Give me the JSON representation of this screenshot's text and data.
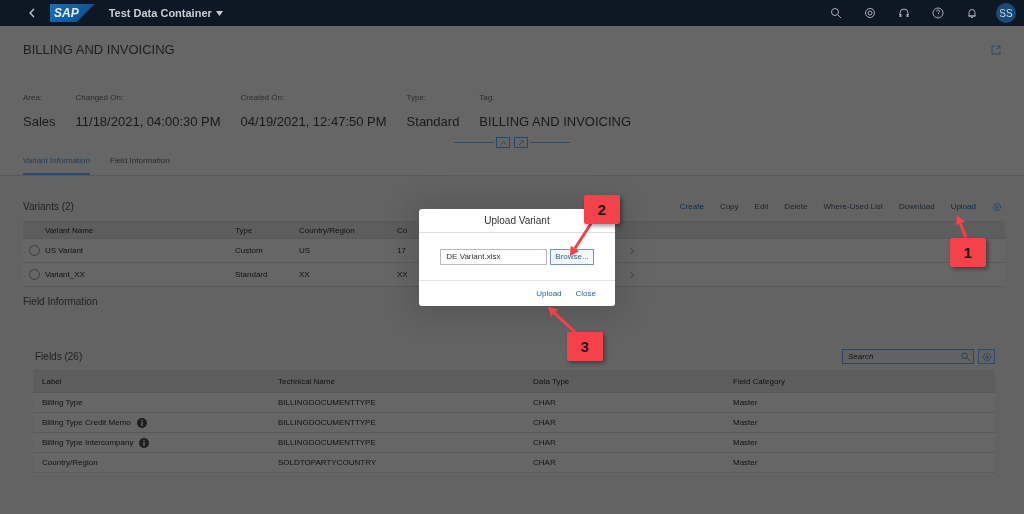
{
  "shell": {
    "logo": "SAP",
    "title": "Test Data Container",
    "avatar": "SS"
  },
  "header": {
    "title": "BILLING AND INVOICING",
    "attributes": [
      {
        "label": "Area:",
        "value": "Sales"
      },
      {
        "label": "Changed On:",
        "value": "11/18/2021, 04:00:30 PM"
      },
      {
        "label": "Created On:",
        "value": "04/19/2021, 12:47:50 PM"
      },
      {
        "label": "Type:",
        "value": "Standard"
      },
      {
        "label": "Tag:",
        "value": "BILLING AND INVOICING"
      }
    ]
  },
  "tabs": [
    {
      "label": "Variant Information",
      "selected": true
    },
    {
      "label": "Field Information",
      "selected": false
    }
  ],
  "variants": {
    "title": "Variants (2)",
    "actions": [
      {
        "label": "Create",
        "disabled": false
      },
      {
        "label": "Copy",
        "disabled": true
      },
      {
        "label": "Edit",
        "disabled": true
      },
      {
        "label": "Delete",
        "disabled": true
      },
      {
        "label": "Where-Used List",
        "disabled": true
      },
      {
        "label": "Download",
        "disabled": true
      },
      {
        "label": "Upload",
        "disabled": false
      }
    ],
    "columns": [
      "Variant Name",
      "Type",
      "Country/Region",
      "Co"
    ],
    "rows": [
      {
        "selected": false,
        "cells": [
          "US Variant",
          "Custom",
          "US",
          "17"
        ]
      },
      {
        "selected": false,
        "cells": [
          "Variant_XX",
          "Standard",
          "XX",
          "XX"
        ]
      }
    ]
  },
  "field_info": {
    "title": "Field Information"
  },
  "fields": {
    "title": "Fields (26)",
    "search": {
      "placeholder": "Search"
    },
    "columns": [
      "Label",
      "Technical Name",
      "Data Type",
      "Field Category"
    ],
    "rows": [
      {
        "info": false,
        "cells": [
          "Billing Type",
          "BILLINGDOCUMENTTYPE",
          "CHAR",
          "Master"
        ]
      },
      {
        "info": true,
        "cells": [
          "Billing Type Credit Memo",
          "BILLINGDOCUMENTTYPE",
          "CHAR",
          "Master"
        ]
      },
      {
        "info": true,
        "cells": [
          "Billing Type Intercompany",
          "BILLINGDOCUMENTTYPE",
          "CHAR",
          "Master"
        ]
      },
      {
        "info": false,
        "cells": [
          "Country/Region",
          "SOLDTOPARTYCOUNTRY",
          "CHAR",
          "Master"
        ]
      }
    ]
  },
  "dialog": {
    "title": "Upload Variant",
    "file": "DE Variant.xlsx",
    "browse": "Browse...",
    "buttons": [
      "Upload",
      "Close"
    ]
  },
  "callouts": [
    "1",
    "2",
    "3"
  ]
}
